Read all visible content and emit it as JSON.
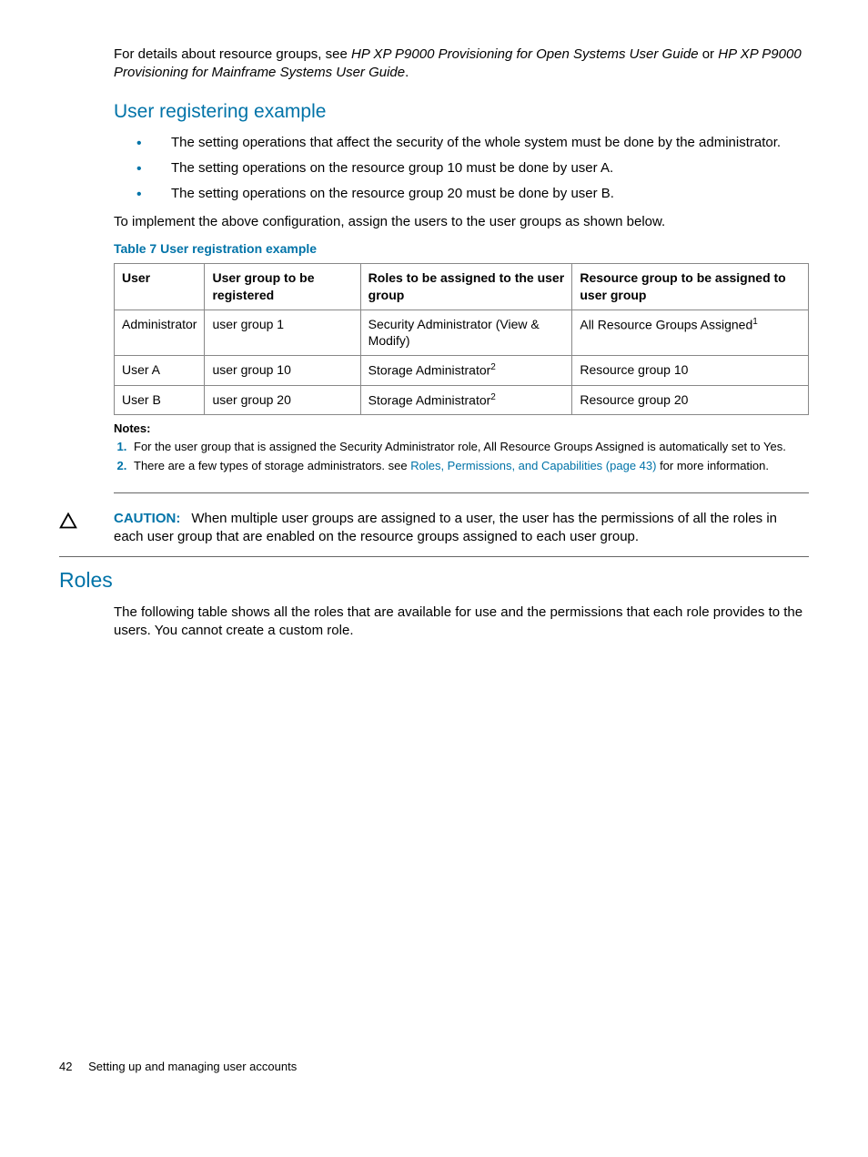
{
  "intro": {
    "prefix": "For details about resource groups, see ",
    "ref1": "HP XP P9000 Provisioning for Open Systems User Guide",
    "mid": " or ",
    "ref2": "HP XP P9000 Provisioning for Mainframe Systems User Guide",
    "suffix": "."
  },
  "section1_title": "User registering example",
  "bullets": [
    "The setting operations that affect the security of the whole system must be done by the administrator.",
    "The setting operations on the resource group 10 must be done by user A.",
    "The setting operations on the resource group 20 must be done by user B."
  ],
  "implement_line": "To implement the above configuration, assign the users to the user groups as shown below.",
  "table_title": "Table 7 User registration example",
  "table": {
    "headers": [
      "User",
      "User group to be registered",
      "Roles to be assigned to the user group",
      "Resource group to be assigned to user group"
    ],
    "rows": [
      {
        "user": "Administrator",
        "group": "user group 1",
        "role": "Security Administrator (View & Modify)",
        "rg": "All Resource Groups Assigned",
        "rg_sup": "1"
      },
      {
        "user": "User A",
        "group": "user group 10",
        "role": "Storage Administrator",
        "role_sup": "2",
        "rg": "Resource group 10"
      },
      {
        "user": "User B",
        "group": "user group 20",
        "role": "Storage Administrator",
        "role_sup": "2",
        "rg": "Resource group 20"
      }
    ]
  },
  "notes": {
    "label": "Notes:",
    "items": [
      {
        "text": "For the user group that is assigned the Security Administrator role, All Resource Groups Assigned is automatically set to Yes."
      },
      {
        "pre": "There are a few types of storage administrators. see ",
        "link": "Roles, Permissions, and Capabilities (page 43)",
        "post": " for more information."
      }
    ]
  },
  "caution": {
    "label": "CAUTION:",
    "text": "When multiple user groups are assigned to a user, the user has the permissions of all the roles in each user group that are enabled on the resource groups assigned to each user group."
  },
  "section2_title": "Roles",
  "roles_para": "The following table shows all the roles that are available for use and the permissions that each role provides to the users. You cannot create a custom role.",
  "footer": {
    "page": "42",
    "chapter": "Setting up and managing user accounts"
  }
}
